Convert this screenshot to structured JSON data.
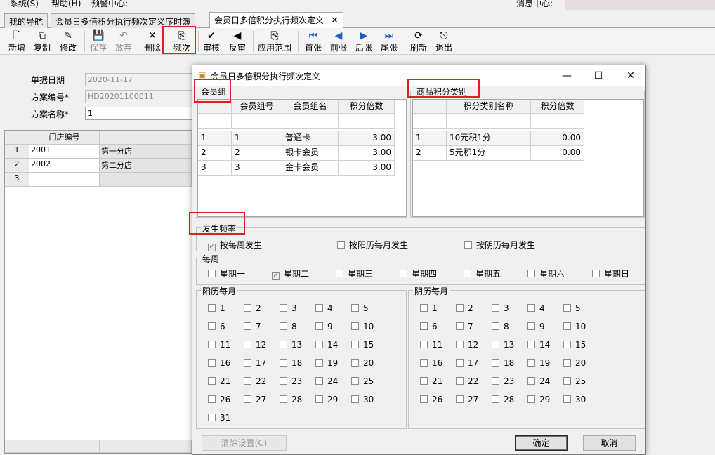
{
  "menubar": {
    "items": [
      "系统(S)",
      "帮助(H)",
      "预警中心:"
    ],
    "message_center": "消息中心:"
  },
  "tabs": [
    {
      "label": "我的导航"
    },
    {
      "label": "会员日多倍积分执行频次定义序时簿"
    },
    {
      "label": "会员日多倍积分执行频次定义",
      "close": "✕"
    }
  ],
  "toolbar": {
    "buttons": [
      {
        "label": "新增",
        "icon": "new-doc-icon",
        "glyph": "🗋"
      },
      {
        "label": "复制",
        "icon": "copy-icon",
        "glyph": "⧉"
      },
      {
        "label": "修改",
        "icon": "edit-icon",
        "glyph": "✎"
      },
      {
        "label": "保存",
        "icon": "save-icon",
        "glyph": "💾"
      },
      {
        "label": "放弃",
        "icon": "undo-icon",
        "glyph": "↶"
      },
      {
        "label": "删除",
        "icon": "delete-icon",
        "glyph": "✕"
      },
      {
        "label": "频次",
        "icon": "frequency-icon",
        "glyph": "⎘"
      },
      {
        "label": "审核",
        "icon": "audit-icon",
        "glyph": "✔"
      },
      {
        "label": "反审",
        "icon": "unaudit-icon",
        "glyph": "◀"
      },
      {
        "label": "应用范围",
        "icon": "scope-icon",
        "glyph": "⎘"
      },
      {
        "label": "首张",
        "icon": "first-icon",
        "glyph": "⏮"
      },
      {
        "label": "前张",
        "icon": "prev-icon",
        "glyph": "◀"
      },
      {
        "label": "后张",
        "icon": "next-icon",
        "glyph": "▶"
      },
      {
        "label": "尾张",
        "icon": "last-icon",
        "glyph": "⏭"
      },
      {
        "label": "刷新",
        "icon": "refresh-icon",
        "glyph": "⟳"
      },
      {
        "label": "退出",
        "icon": "exit-icon",
        "glyph": "⎋"
      }
    ]
  },
  "form": {
    "date_label": "单据日期",
    "date_value": "2020-11-17",
    "code_label": "方案编号*",
    "code_value": "HD20201100011",
    "name_label": "方案名称*",
    "name_value": "1"
  },
  "store_grid": {
    "col_header": "门店编号",
    "rows": [
      {
        "no": "1",
        "code": "2001",
        "name": "第一分店"
      },
      {
        "no": "2",
        "code": "2002",
        "name": "第二分店"
      },
      {
        "no": "3",
        "code": "",
        "name": ""
      }
    ]
  },
  "dialog": {
    "title": "会员日多倍积分执行频次定义",
    "controls": {
      "minimize": "—",
      "maximize": "☐",
      "close": "✕"
    },
    "member_group": {
      "title": "会员组",
      "headers": [
        "会员组号",
        "会员组名",
        "积分倍数"
      ],
      "rows": [
        {
          "no": "1",
          "code": "1",
          "name": "普通卡",
          "multiplier": "3.00"
        },
        {
          "no": "2",
          "code": "2",
          "name": "银卡会员",
          "multiplier": "3.00"
        },
        {
          "no": "3",
          "code": "3",
          "name": "金卡会员",
          "multiplier": "3.00"
        }
      ]
    },
    "product_category": {
      "title": "商品积分类别",
      "headers": [
        "积分类别名称",
        "积分倍数"
      ],
      "rows": [
        {
          "no": "1",
          "name": "10元积1分",
          "multiplier": "0.00"
        },
        {
          "no": "2",
          "name": "5元积1分",
          "multiplier": "0.00"
        }
      ]
    },
    "frequency": {
      "title": "发生频率",
      "options": [
        {
          "label": "按每周发生",
          "checked": true
        },
        {
          "label": "按阳历每月发生",
          "checked": false
        },
        {
          "label": "按阴历每月发生",
          "checked": false
        }
      ]
    },
    "weekly": {
      "title": "每周",
      "days": [
        {
          "label": "星期一",
          "checked": false
        },
        {
          "label": "星期二",
          "checked": true
        },
        {
          "label": "星期三",
          "checked": false
        },
        {
          "label": "星期四",
          "checked": false
        },
        {
          "label": "星期五",
          "checked": false
        },
        {
          "label": "星期六",
          "checked": false
        },
        {
          "label": "星期日",
          "checked": false
        }
      ]
    },
    "solar_month": {
      "title": "阳历每月",
      "days": [
        "1",
        "2",
        "3",
        "4",
        "5",
        "6",
        "7",
        "8",
        "9",
        "10",
        "11",
        "12",
        "13",
        "14",
        "15",
        "16",
        "17",
        "18",
        "19",
        "20",
        "21",
        "22",
        "23",
        "24",
        "25",
        "26",
        "27",
        "28",
        "29",
        "30",
        "31"
      ]
    },
    "lunar_month": {
      "title": "阴历每月",
      "days": [
        "1",
        "2",
        "3",
        "4",
        "5",
        "6",
        "7",
        "8",
        "9",
        "10",
        "11",
        "12",
        "13",
        "14",
        "15",
        "16",
        "17",
        "18",
        "19",
        "20",
        "21",
        "22",
        "23",
        "24",
        "25",
        "26",
        "27",
        "28",
        "29",
        "30"
      ]
    },
    "buttons": {
      "clear": "清除设置(C)",
      "ok": "确定",
      "cancel": "取消"
    }
  },
  "colors": {
    "highlight_box": "#e02020"
  }
}
